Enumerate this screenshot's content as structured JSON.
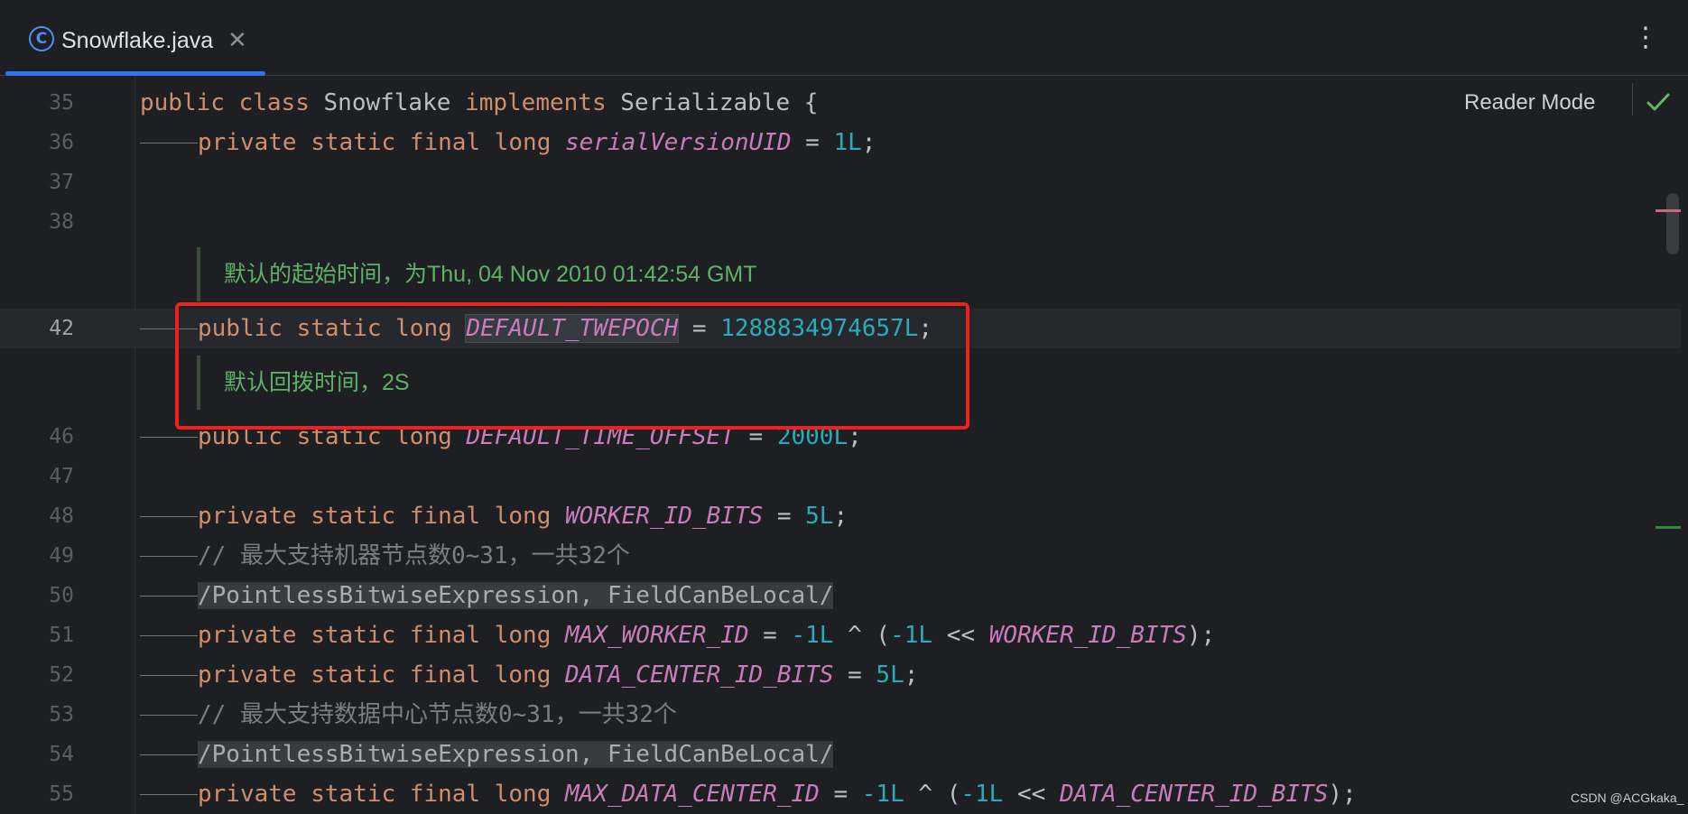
{
  "tab": {
    "icon_glyph": "C",
    "file_name": "Snowflake.java",
    "close_glyph": "✕"
  },
  "toolbar": {
    "more_glyph": "⋮",
    "reader_mode_label": "Reader Mode"
  },
  "lines": {
    "l35": {
      "num": "35"
    },
    "l36": {
      "num": "36"
    },
    "l37": {
      "num": "37"
    },
    "l38": {
      "num": "38"
    },
    "l42": {
      "num": "42"
    },
    "l46": {
      "num": "46"
    },
    "l47": {
      "num": "47"
    },
    "l48": {
      "num": "48"
    },
    "l49": {
      "num": "49"
    },
    "l50": {
      "num": "50"
    },
    "l51": {
      "num": "51"
    },
    "l52": {
      "num": "52"
    },
    "l53": {
      "num": "53"
    },
    "l54": {
      "num": "54"
    },
    "l55": {
      "num": "55"
    }
  },
  "tokens": {
    "public": "public",
    "private": "private",
    "static": "static",
    "final": "final",
    "long": "long",
    "class": "class",
    "implements": "implements",
    "class_name": "Snowflake",
    "iface": "Serializable",
    "brace": "{",
    "serial_uid": "serialVersionUID",
    "one_l": "1L",
    "twepoch": "DEFAULT_TWEPOCH",
    "twepoch_val": "1288834974657L",
    "time_offset": "DEFAULT_TIME_OFFSET",
    "time_offset_val": "2000L",
    "worker_bits": "WORKER_ID_BITS",
    "five_l": "5L",
    "comment_worker": "// 最大支持机器节点数0~31，一共32个",
    "suppress": "/PointlessBitwiseExpression, FieldCanBeLocal/",
    "max_worker": "MAX_WORKER_ID",
    "neg_one_l": "-1L",
    "dc_bits": "DATA_CENTER_ID_BITS",
    "comment_dc": "// 最大支持数据中心节点数0~31，一共32个",
    "max_dc": "MAX_DATA_CENTER_ID"
  },
  "docs": {
    "twepoch_doc": "默认的起始时间，为Thu, 04 Nov 2010 01:42:54 GMT",
    "offset_doc": "默认回拨时间，2S"
  },
  "watermark": "CSDN @ACGkaka_",
  "colors": {
    "accent": "#3574f0",
    "keyword": "#cf8e6d",
    "constant": "#c77dbb",
    "number": "#2aacb8",
    "doc_text": "#5fb168",
    "annotation_box": "#ee2121"
  }
}
